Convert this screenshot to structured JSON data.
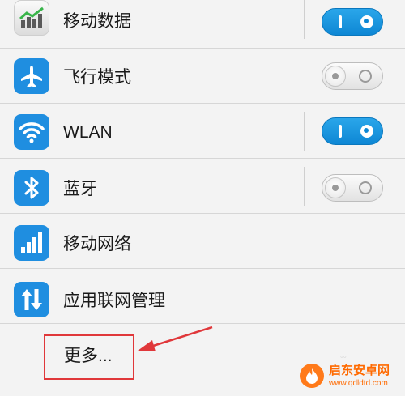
{
  "settings": {
    "items": [
      {
        "label": "移动数据",
        "icon": "chart-icon",
        "toggle": "on"
      },
      {
        "label": "飞行模式",
        "icon": "airplane-icon",
        "toggle": "off"
      },
      {
        "label": "WLAN",
        "icon": "wifi-icon",
        "toggle": "on"
      },
      {
        "label": "蓝牙",
        "icon": "bluetooth-icon",
        "toggle": "off"
      },
      {
        "label": "移动网络",
        "icon": "signal-bars-icon"
      },
      {
        "label": "应用联网管理",
        "icon": "updown-arrows-icon"
      }
    ],
    "more_label": "更多..."
  },
  "annotation": {
    "highlight_color": "#e0373a",
    "arrow_color": "#e0373a"
  },
  "colors": {
    "toggle_on": "#1a96e0",
    "icon_blue": "#1f8ee0",
    "background": "#f3f3f3"
  },
  "watermark": {
    "name": "启东安卓网",
    "url": "www.qdldtd.com",
    "icon": "flame-icon"
  }
}
